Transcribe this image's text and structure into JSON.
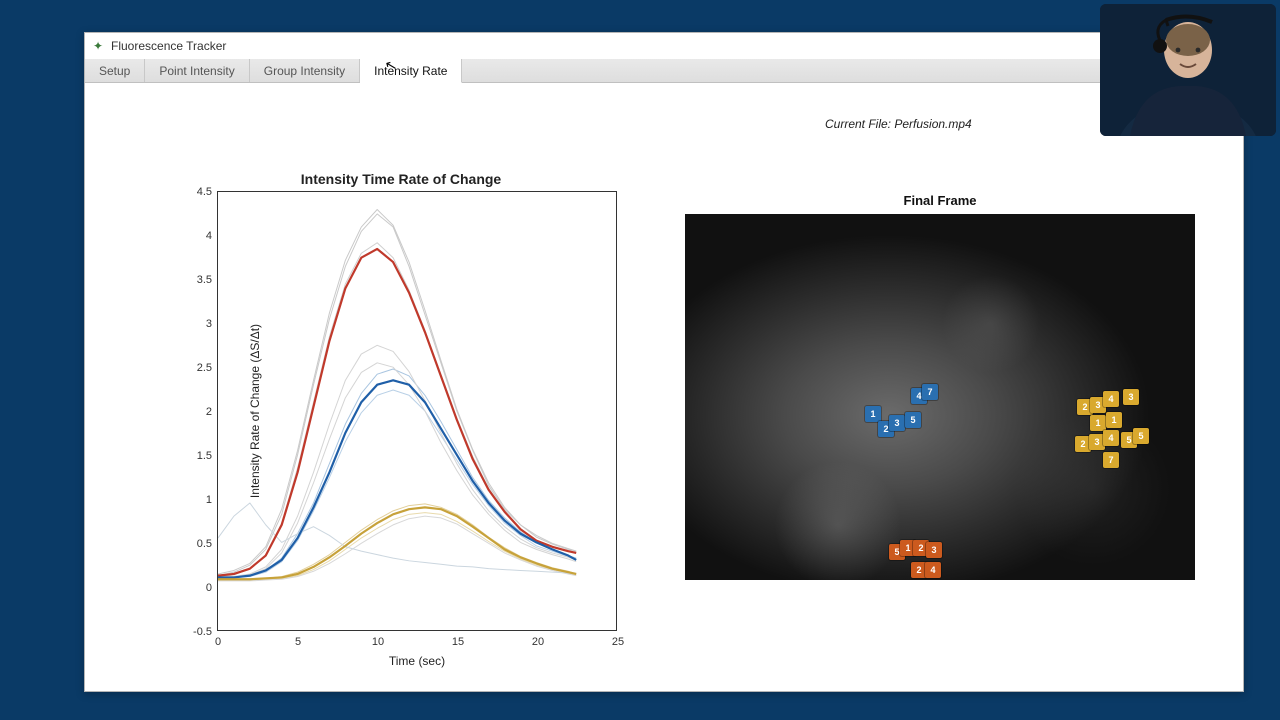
{
  "window": {
    "title": "Fluorescence Tracker",
    "minimize": "—"
  },
  "tabs": [
    {
      "label": "Setup"
    },
    {
      "label": "Point Intensity"
    },
    {
      "label": "Group Intensity"
    },
    {
      "label": "Intensity Rate"
    }
  ],
  "active_tab_index": 3,
  "current_file_prefix": "Current File: ",
  "current_file_name": "Perfusion.mp4",
  "chart_data": {
    "type": "line",
    "title": "Intensity Time Rate of Change",
    "xlabel": "Time (sec)",
    "ylabel": "Intensity Rate of Change (ΔS/Δt)",
    "xlim": [
      0,
      25
    ],
    "ylim": [
      -0.5,
      4.5
    ],
    "xticks": [
      0,
      5,
      10,
      15,
      20,
      25
    ],
    "yticks": [
      -0.5,
      0,
      0.5,
      1,
      1.5,
      2,
      2.5,
      3,
      3.5,
      4,
      4.5
    ],
    "x": [
      0,
      1,
      2,
      3,
      4,
      5,
      6,
      7,
      8,
      9,
      10,
      11,
      12,
      13,
      14,
      15,
      16,
      17,
      18,
      19,
      20,
      21,
      22,
      22.5
    ],
    "series": [
      {
        "name": "red_mean",
        "color": "#c0392b",
        "width": 2.2,
        "values": [
          0.12,
          0.14,
          0.2,
          0.35,
          0.7,
          1.3,
          2.05,
          2.8,
          3.4,
          3.75,
          3.85,
          3.7,
          3.35,
          2.9,
          2.4,
          1.9,
          1.45,
          1.1,
          0.85,
          0.65,
          0.52,
          0.45,
          0.4,
          0.38
        ]
      },
      {
        "name": "blue_mean",
        "color": "#1f5fa8",
        "width": 2.2,
        "values": [
          0.1,
          0.1,
          0.12,
          0.18,
          0.3,
          0.55,
          0.9,
          1.3,
          1.75,
          2.1,
          2.3,
          2.35,
          2.3,
          2.1,
          1.8,
          1.5,
          1.2,
          0.95,
          0.75,
          0.6,
          0.5,
          0.42,
          0.35,
          0.3
        ]
      },
      {
        "name": "yellow_mean",
        "color": "#c7a23a",
        "width": 2.2,
        "values": [
          0.08,
          0.08,
          0.08,
          0.09,
          0.1,
          0.14,
          0.22,
          0.33,
          0.46,
          0.6,
          0.72,
          0.82,
          0.88,
          0.9,
          0.88,
          0.8,
          0.68,
          0.55,
          0.42,
          0.33,
          0.26,
          0.2,
          0.16,
          0.14
        ]
      },
      {
        "name": "gray_hi_1",
        "color": "#c9c9c9",
        "width": 1,
        "values": [
          0.12,
          0.16,
          0.24,
          0.42,
          0.82,
          1.5,
          2.3,
          3.05,
          3.65,
          4.05,
          4.25,
          4.1,
          3.65,
          3.1,
          2.55,
          2.0,
          1.55,
          1.15,
          0.88,
          0.7,
          0.56,
          0.48,
          0.42,
          0.4
        ]
      },
      {
        "name": "gray_hi_2",
        "color": "#c9c9c9",
        "width": 1,
        "values": [
          0.14,
          0.18,
          0.26,
          0.45,
          0.88,
          1.55,
          2.35,
          3.12,
          3.72,
          4.1,
          4.3,
          4.12,
          3.7,
          3.15,
          2.58,
          2.02,
          1.56,
          1.18,
          0.9,
          0.7,
          0.58,
          0.49,
          0.43,
          0.4
        ]
      },
      {
        "name": "gray_hi_3",
        "color": "#cfcfcf",
        "width": 1,
        "values": [
          0.1,
          0.13,
          0.2,
          0.36,
          0.72,
          1.35,
          2.1,
          2.85,
          3.45,
          3.8,
          3.92,
          3.75,
          3.38,
          2.92,
          2.42,
          1.92,
          1.48,
          1.12,
          0.86,
          0.66,
          0.52,
          0.45,
          0.4,
          0.38
        ]
      },
      {
        "name": "lightblue_1",
        "color": "#a9c5e0",
        "width": 1,
        "values": [
          0.1,
          0.1,
          0.12,
          0.18,
          0.32,
          0.6,
          0.95,
          1.4,
          1.85,
          2.2,
          2.42,
          2.48,
          2.4,
          2.18,
          1.88,
          1.56,
          1.24,
          0.98,
          0.78,
          0.62,
          0.5,
          0.42,
          0.35,
          0.32
        ]
      },
      {
        "name": "lightblue_2",
        "color": "#b9d0e6",
        "width": 1,
        "values": [
          0.1,
          0.1,
          0.11,
          0.16,
          0.28,
          0.52,
          0.86,
          1.24,
          1.65,
          1.98,
          2.18,
          2.24,
          2.18,
          2.0,
          1.72,
          1.44,
          1.16,
          0.92,
          0.72,
          0.58,
          0.46,
          0.4,
          0.34,
          0.3
        ]
      },
      {
        "name": "gray_mid_1",
        "color": "#d4d4d4",
        "width": 1,
        "values": [
          0.1,
          0.11,
          0.14,
          0.22,
          0.42,
          0.8,
          1.3,
          1.85,
          2.35,
          2.65,
          2.75,
          2.68,
          2.45,
          2.12,
          1.75,
          1.4,
          1.1,
          0.86,
          0.68,
          0.54,
          0.44,
          0.38,
          0.33,
          0.3
        ]
      },
      {
        "name": "gray_mid_2",
        "color": "#d4d4d4",
        "width": 1,
        "values": [
          0.1,
          0.11,
          0.13,
          0.2,
          0.38,
          0.72,
          1.18,
          1.68,
          2.15,
          2.44,
          2.55,
          2.5,
          2.3,
          2.0,
          1.64,
          1.32,
          1.04,
          0.82,
          0.64,
          0.5,
          0.42,
          0.36,
          0.31,
          0.28
        ]
      },
      {
        "name": "tan_1",
        "color": "#e2cf9a",
        "width": 1,
        "values": [
          0.08,
          0.08,
          0.08,
          0.09,
          0.11,
          0.16,
          0.25,
          0.36,
          0.5,
          0.64,
          0.76,
          0.86,
          0.92,
          0.94,
          0.9,
          0.82,
          0.7,
          0.56,
          0.44,
          0.34,
          0.27,
          0.21,
          0.17,
          0.14
        ]
      },
      {
        "name": "tan_2",
        "color": "#e8daac",
        "width": 1,
        "values": [
          0.07,
          0.07,
          0.07,
          0.08,
          0.09,
          0.12,
          0.19,
          0.29,
          0.42,
          0.55,
          0.66,
          0.76,
          0.82,
          0.84,
          0.82,
          0.74,
          0.63,
          0.51,
          0.4,
          0.31,
          0.24,
          0.19,
          0.15,
          0.13
        ]
      },
      {
        "name": "gray_low",
        "color": "#d8d8d8",
        "width": 1,
        "values": [
          0.06,
          0.06,
          0.06,
          0.07,
          0.08,
          0.11,
          0.17,
          0.26,
          0.37,
          0.49,
          0.6,
          0.7,
          0.77,
          0.8,
          0.78,
          0.71,
          0.6,
          0.49,
          0.38,
          0.3,
          0.23,
          0.18,
          0.14,
          0.12
        ]
      },
      {
        "name": "wobble_left",
        "color": "#cbd6df",
        "width": 1,
        "values": [
          0.55,
          0.8,
          0.95,
          0.7,
          0.5,
          0.6,
          0.68,
          0.58,
          0.45,
          0.4,
          0.36,
          0.32,
          0.29,
          0.27,
          0.25,
          0.23,
          0.22,
          0.2,
          0.19,
          0.18,
          0.17,
          0.16,
          0.15,
          0.14
        ]
      }
    ]
  },
  "frame": {
    "title": "Final Frame",
    "markers": {
      "blue": [
        {
          "n": "1",
          "x": 180,
          "y": 192
        },
        {
          "n": "2",
          "x": 193,
          "y": 207
        },
        {
          "n": "3",
          "x": 204,
          "y": 201
        },
        {
          "n": "4",
          "x": 226,
          "y": 174
        },
        {
          "n": "5",
          "x": 220,
          "y": 198
        },
        {
          "n": "7",
          "x": 237,
          "y": 170
        }
      ],
      "yellow": [
        {
          "n": "2",
          "x": 392,
          "y": 185
        },
        {
          "n": "3",
          "x": 405,
          "y": 183
        },
        {
          "n": "4",
          "x": 418,
          "y": 177
        },
        {
          "n": "3",
          "x": 438,
          "y": 175
        },
        {
          "n": "1",
          "x": 405,
          "y": 201
        },
        {
          "n": "1",
          "x": 421,
          "y": 198
        },
        {
          "n": "5",
          "x": 436,
          "y": 218
        },
        {
          "n": "2",
          "x": 390,
          "y": 222
        },
        {
          "n": "3",
          "x": 404,
          "y": 220
        },
        {
          "n": "4",
          "x": 418,
          "y": 216
        },
        {
          "n": "5",
          "x": 448,
          "y": 214
        },
        {
          "n": "7",
          "x": 418,
          "y": 238
        }
      ],
      "orange": [
        {
          "n": "5",
          "x": 204,
          "y": 330
        },
        {
          "n": "1",
          "x": 215,
          "y": 326
        },
        {
          "n": "2",
          "x": 228,
          "y": 326
        },
        {
          "n": "3",
          "x": 241,
          "y": 328
        },
        {
          "n": "2",
          "x": 226,
          "y": 348
        },
        {
          "n": "4",
          "x": 240,
          "y": 348
        }
      ]
    }
  }
}
